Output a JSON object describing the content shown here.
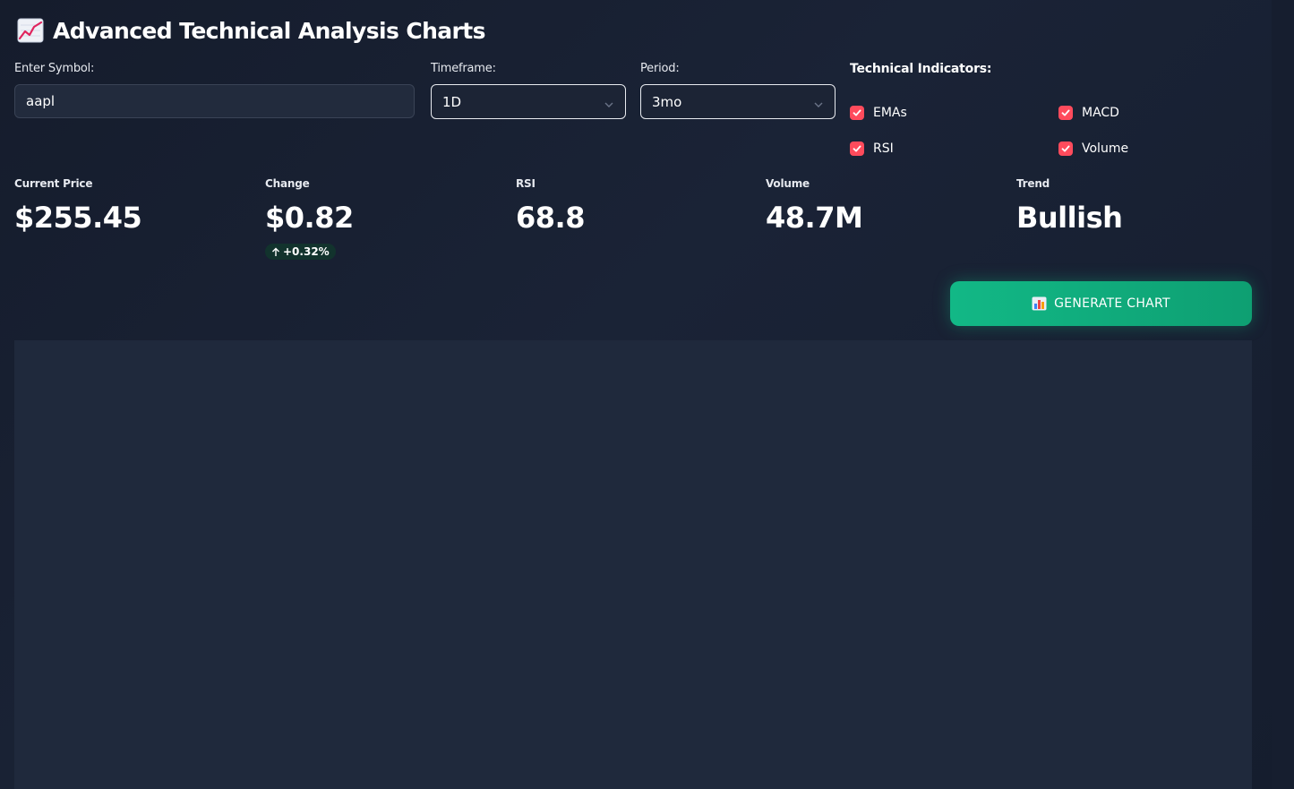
{
  "header": {
    "title": "Advanced Technical Analysis Charts",
    "icon": "chart-increasing-icon"
  },
  "controls": {
    "symbol": {
      "label": "Enter Symbol:",
      "value": "aapl"
    },
    "timeframe": {
      "label": "Timeframe:",
      "value": "1D"
    },
    "period": {
      "label": "Period:",
      "value": "3mo"
    }
  },
  "indicators": {
    "title": "Technical Indicators:",
    "items": [
      {
        "label": "EMAs",
        "checked": true
      },
      {
        "label": "MACD",
        "checked": true
      },
      {
        "label": "RSI",
        "checked": true
      },
      {
        "label": "Volume",
        "checked": true
      }
    ],
    "check_color": "#ff4b5c"
  },
  "metrics": [
    {
      "label": "Current Price",
      "value": "$255.45"
    },
    {
      "label": "Change",
      "value": "$0.82",
      "delta": "+0.32%"
    },
    {
      "label": "RSI",
      "value": "68.8"
    },
    {
      "label": "Volume",
      "value": "48.7M"
    },
    {
      "label": "Trend",
      "value": "Bullish"
    }
  ],
  "actions": {
    "generate_label": "GENERATE CHART",
    "generate_icon": "bar-chart-icon",
    "button_color": "#10b981"
  },
  "colors": {
    "background": "#151d2e",
    "panel": "#1f293c",
    "delta_positive_bg": "#12332d"
  }
}
